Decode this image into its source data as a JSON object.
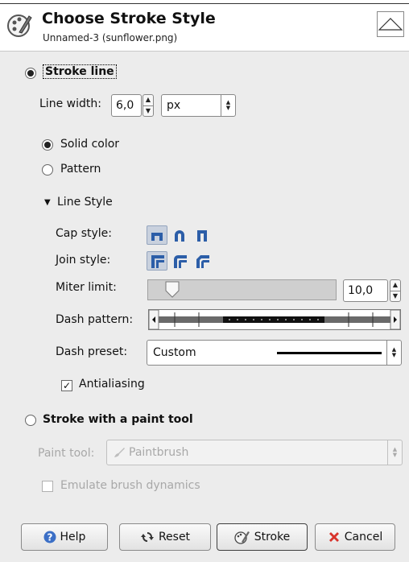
{
  "dialog": {
    "title": "Choose Stroke Style",
    "subtitle": "Unnamed-3 (sunflower.png)"
  },
  "stroke_line": {
    "label": "Stroke line",
    "line_width_label": "Line width:",
    "line_width_value": "6,0",
    "unit_value": "px",
    "solid_color_label": "Solid color",
    "pattern_label": "Pattern",
    "line_style_label": "Line Style",
    "cap_style_label": "Cap style:",
    "join_style_label": "Join style:",
    "miter_limit_label": "Miter limit:",
    "miter_limit_value": "10,0",
    "miter_slider_fraction": 0.05,
    "dash_pattern_label": "Dash pattern:",
    "dash_preset_label": "Dash preset:",
    "dash_preset_value": "Custom",
    "antialiasing_label": "Antialiasing"
  },
  "paint_tool": {
    "label": "Stroke with a paint tool",
    "paint_tool_label": "Paint tool:",
    "paint_tool_value": "Paintbrush",
    "emulate_label": "Emulate brush dynamics"
  },
  "buttons": {
    "help": "Help",
    "reset": "Reset",
    "stroke": "Stroke",
    "cancel": "Cancel"
  },
  "colors": {
    "help_icon": "#3b6fc6",
    "cancel_icon": "#d8332b",
    "style_icon": "#2c5ea8"
  }
}
